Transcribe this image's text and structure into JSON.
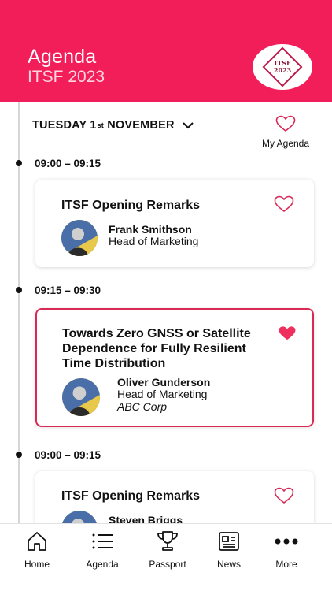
{
  "header": {
    "title": "Agenda",
    "subtitle": "ITSF 2023",
    "logo_text": "ITSF 2023"
  },
  "day_selector": {
    "day": "TUESDAY 1",
    "day_suffix": "st",
    "month": "NOVEMBER"
  },
  "my_agenda_label": "My Agenda",
  "sessions": [
    {
      "time": "09:00 – 09:15",
      "title": "ITSF Opening Remarks",
      "speaker": "Frank Smithson",
      "role": "Head of Marketing",
      "favorited": false
    },
    {
      "time": "09:15 – 09:30",
      "title_lines": [
        "Towards Zero GNSS or Satellite",
        "Dependence for Fully Resilient",
        "Time Distribution"
      ],
      "speaker": "Oliver Gunderson",
      "role": "Head of Marketing",
      "org": "ABC Corp",
      "favorited": true
    },
    {
      "time": "09:00 – 09:15",
      "title": "ITSF Opening Remarks",
      "speaker": "Steven Briggs",
      "favorited": false
    }
  ],
  "nav": [
    {
      "label": "Home",
      "icon": "home-icon"
    },
    {
      "label": "Agenda",
      "icon": "list-icon"
    },
    {
      "label": "Passport",
      "icon": "trophy-icon"
    },
    {
      "label": "News",
      "icon": "newspaper-icon"
    },
    {
      "label": "More",
      "icon": "more-icon"
    }
  ],
  "colors": {
    "brand": "#f21e5a",
    "accent": "#d92a55"
  }
}
